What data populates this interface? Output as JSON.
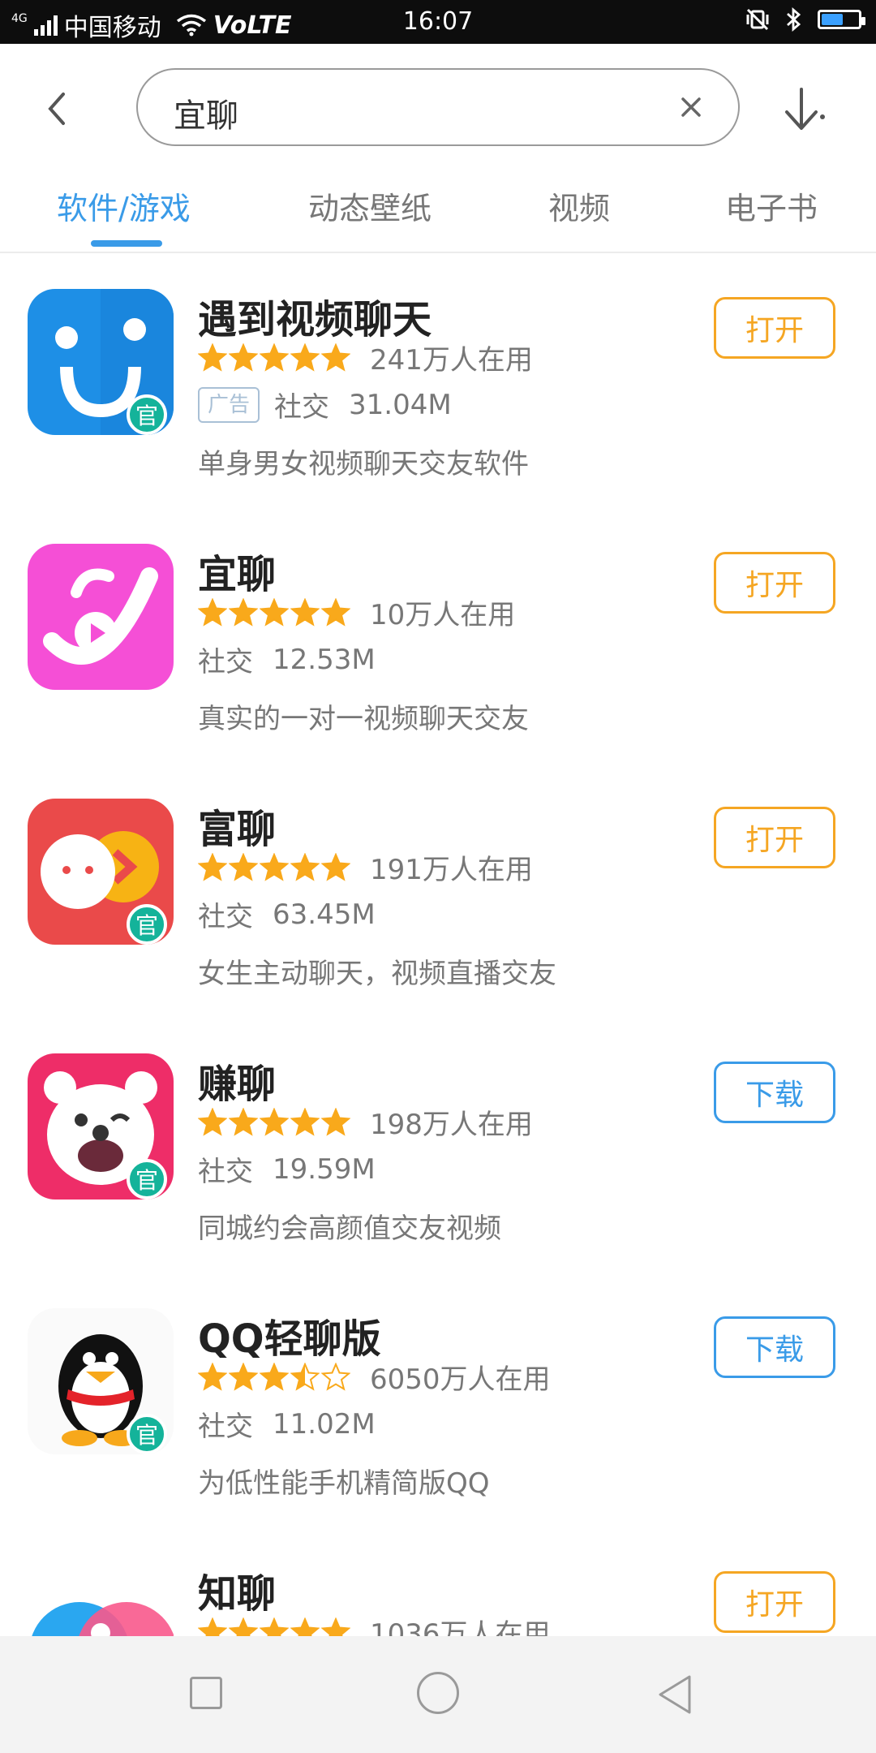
{
  "status_bar": {
    "network": "4G",
    "carrier": "中国移动",
    "volte": "VoLTE",
    "time": "16:07",
    "battery_level": 0.6
  },
  "search": {
    "back_icon": "chevron-left-icon",
    "query": "宜聊",
    "clear_icon": "close-icon",
    "download_icon": "download-arrow-icon"
  },
  "tabs": [
    {
      "label": "软件/游戏",
      "active": true
    },
    {
      "label": "动态壁纸",
      "active": false
    },
    {
      "label": "视频",
      "active": false
    },
    {
      "label": "电子书",
      "active": false
    }
  ],
  "apps": [
    {
      "name": "遇到视频聊天",
      "rating": 5,
      "users": "241万人在用",
      "ad": "广告",
      "category": "社交",
      "size": "31.04M",
      "description": "单身男女视频聊天交友软件",
      "action": "打开",
      "official": "官",
      "icon_color": "#1e8fe6"
    },
    {
      "name": "宜聊",
      "rating": 5,
      "users": "10万人在用",
      "ad": "",
      "category": "社交",
      "size": "12.53M",
      "description": "真实的一对一视频聊天交友",
      "action": "打开",
      "official": "",
      "icon_color": "#f54fd6"
    },
    {
      "name": "富聊",
      "rating": 5,
      "users": "191万人在用",
      "ad": "",
      "category": "社交",
      "size": "63.45M",
      "description": "女生主动聊天，视频直播交友",
      "action": "打开",
      "official": "官",
      "icon_color": "#ea4a4a"
    },
    {
      "name": "赚聊",
      "rating": 5,
      "users": "198万人在用",
      "ad": "",
      "category": "社交",
      "size": "19.59M",
      "description": "同城约会高颜值交友视频",
      "action": "下载",
      "official": "官",
      "icon_color": "#ee2d68"
    },
    {
      "name": "QQ轻聊版",
      "rating": 3.5,
      "users": "6050万人在用",
      "ad": "",
      "category": "社交",
      "size": "11.02M",
      "description": "为低性能手机精简版QQ",
      "action": "下载",
      "official": "官",
      "icon_color": "#ffffff"
    },
    {
      "name": "知聊",
      "rating": 5,
      "users": "1036万人在用",
      "ad": "",
      "category": "",
      "size": "",
      "description": "",
      "action": "打开",
      "official": "",
      "icon_color": "#2aa7f0"
    }
  ],
  "nav_bar": {
    "recent_icon": "square-recents-icon",
    "home_icon": "circle-home-icon",
    "back_icon": "triangle-back-icon"
  },
  "colors": {
    "accent_blue": "#3a9be8",
    "open_orange": "#f5a623",
    "star": "#f9a91b",
    "official_badge": "#14b39a"
  }
}
